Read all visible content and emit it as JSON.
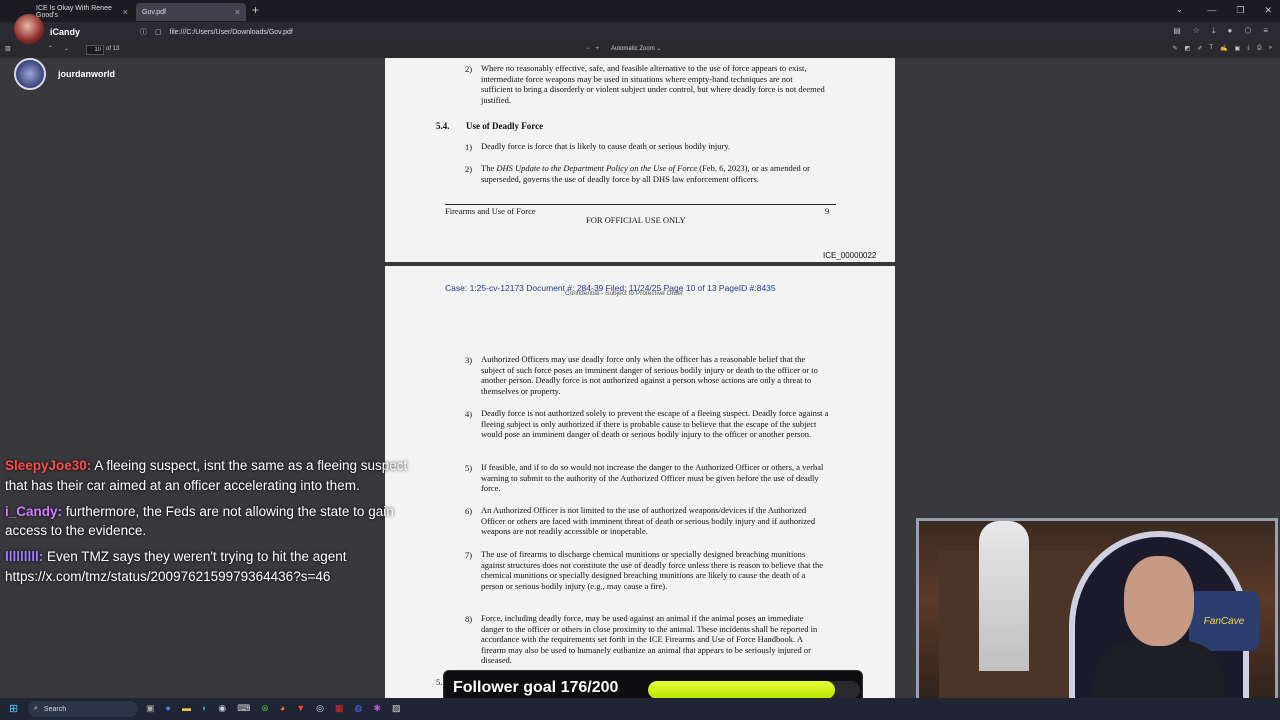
{
  "browser": {
    "tabs": [
      {
        "title": "ICE Is Okay With Renee Good's",
        "active": false
      },
      {
        "title": "Gov.pdf",
        "active": true
      }
    ],
    "url": "file:///C:/Users/User/Downloads/Gov.pdf"
  },
  "pdf_toolbar": {
    "page_number": "10",
    "page_total": "of 13",
    "zoom": "Automatic Zoom"
  },
  "stream": {
    "channel_name": "iCandy",
    "guest_name": "jourdanworld"
  },
  "page9": {
    "item2_num": "2)",
    "item2_text": "Where no reasonably effective, safe, and feasible alternative to the use of force appears to exist, intermediate force weapons may be used in situations where empty-hand techniques are not sufficient to bring a disorderly or violent subject under control, but where deadly force is not deemed justified.",
    "section_num": "5.4.",
    "section_title": "Use of Deadly Force",
    "d1_num": "1)",
    "d1_text": "Deadly force is force that is likely to cause death or serious bodily injury.",
    "d2_num": "2)",
    "d2_text_a": "The ",
    "d2_text_italic": "DHS Update to the Department Policy on the Use of Force",
    "d2_text_b": " (Feb. 6, 2023), or as amended or superseded, governs the use of deadly force by all DHS law enforcement officers.",
    "footer_left": "Firearms and Use of Force",
    "footer_center": "FOR OFFICIAL USE ONLY",
    "footer_page": "9",
    "bates": "ICE_00000022"
  },
  "page10": {
    "case_header": "Case: 1:25-cv-12173 Document #: 284-39 Filed: 11/24/25 Page 10 of 13 PageID #:8435",
    "confidential": "Confidential - Subject to Protective Order",
    "items": [
      {
        "num": "3)",
        "text": "Authorized Officers may use deadly force only when the officer has a reasonable belief that the subject of such force poses an imminent danger of serious bodily injury or death to the officer or to another person. Deadly force is not authorized against a person whose actions are only a threat to themselves or property."
      },
      {
        "num": "4)",
        "text": "Deadly force is not authorized solely to prevent the escape of a fleeing suspect. Deadly force against a fleeing subject is only authorized if there is probable cause to believe that the escape of the subject would pose an imminent danger of death or serious bodily injury to the officer or another person."
      },
      {
        "num": "5)",
        "text": "If feasible, and if to do so would not increase the danger to the Authorized Officer or others, a verbal warning to submit to the authority of the Authorized Officer must be given before the use of deadly force."
      },
      {
        "num": "6)",
        "text": "An Authorized Officer is not limited to the use of authorized weapons/devices if the Authorized Officer or others are faced with imminent threat of death or serious bodily injury and if authorized weapons are not readily accessible or inoperable."
      },
      {
        "num": "7)",
        "text": "The use of firearms to discharge chemical munitions or specially designed breaching munitions against structures does not constitute the use of deadly force unless there is reason to believe that the chemical munitions or specially designed breaching munitions are likely to cause the death of a person or serious bodily injury (e.g., may cause a fire)."
      },
      {
        "num": "8)",
        "text": "Force, including deadly force, may be used against an animal if the animal poses an immediate danger to the officer or others in close proximity to the animal. These incidents shall be reported in accordance with the requirements set forth in the ICE Firearms and Use of Force Handbook. A firearm may also be used to humanely euthanize an animal that appears to be seriously injured or diseased."
      }
    ],
    "next_section_num": "5."
  },
  "chat": {
    "messages": [
      {
        "user": "SleepyJoe30:",
        "user_color": "#ff4b4b",
        "text": "A fleeing suspect, isnt the same as a fleeing suspect that has their car aimed at an officer accelerating into them."
      },
      {
        "user": "i_Candy:",
        "user_color": "#d27cff",
        "text": "furthermore, the Feds are not allowing the state to gain access to the evidence."
      },
      {
        "user": "lllllllll:",
        "user_color": "#9f7bff",
        "text": "Even TMZ says they weren't trying to hit the agent https://x.com/tmz/status/2009762159979364436?s=46"
      }
    ]
  },
  "webcam": {
    "sign_text": "FanCave"
  },
  "follower_goal": {
    "label": "Follower goal 176/200",
    "current": 176,
    "target": 200,
    "fill_color": "#d6f51c"
  },
  "taskbar": {
    "search_label": "Search"
  }
}
